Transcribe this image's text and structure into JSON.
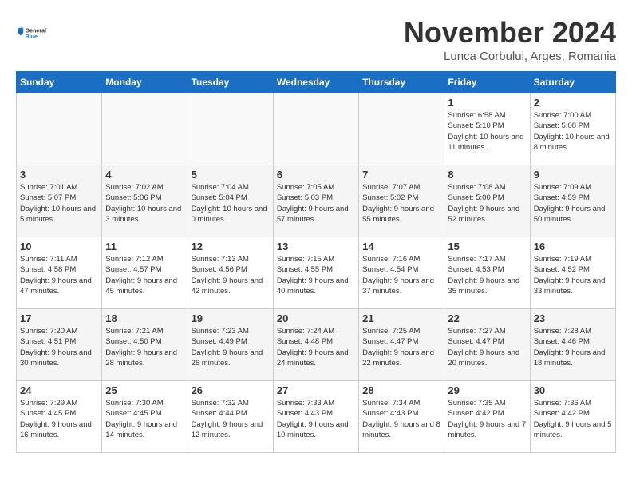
{
  "logo": {
    "line1": "General",
    "line2": "Blue"
  },
  "title": "November 2024",
  "location": "Lunca Corbului, Arges, Romania",
  "weekdays": [
    "Sunday",
    "Monday",
    "Tuesday",
    "Wednesday",
    "Thursday",
    "Friday",
    "Saturday"
  ],
  "weeks": [
    [
      {
        "day": "",
        "info": ""
      },
      {
        "day": "",
        "info": ""
      },
      {
        "day": "",
        "info": ""
      },
      {
        "day": "",
        "info": ""
      },
      {
        "day": "",
        "info": ""
      },
      {
        "day": "1",
        "info": "Sunrise: 6:58 AM\nSunset: 5:10 PM\nDaylight: 10 hours and 11 minutes."
      },
      {
        "day": "2",
        "info": "Sunrise: 7:00 AM\nSunset: 5:08 PM\nDaylight: 10 hours and 8 minutes."
      }
    ],
    [
      {
        "day": "3",
        "info": "Sunrise: 7:01 AM\nSunset: 5:07 PM\nDaylight: 10 hours and 5 minutes."
      },
      {
        "day": "4",
        "info": "Sunrise: 7:02 AM\nSunset: 5:06 PM\nDaylight: 10 hours and 3 minutes."
      },
      {
        "day": "5",
        "info": "Sunrise: 7:04 AM\nSunset: 5:04 PM\nDaylight: 10 hours and 0 minutes."
      },
      {
        "day": "6",
        "info": "Sunrise: 7:05 AM\nSunset: 5:03 PM\nDaylight: 9 hours and 57 minutes."
      },
      {
        "day": "7",
        "info": "Sunrise: 7:07 AM\nSunset: 5:02 PM\nDaylight: 9 hours and 55 minutes."
      },
      {
        "day": "8",
        "info": "Sunrise: 7:08 AM\nSunset: 5:00 PM\nDaylight: 9 hours and 52 minutes."
      },
      {
        "day": "9",
        "info": "Sunrise: 7:09 AM\nSunset: 4:59 PM\nDaylight: 9 hours and 50 minutes."
      }
    ],
    [
      {
        "day": "10",
        "info": "Sunrise: 7:11 AM\nSunset: 4:58 PM\nDaylight: 9 hours and 47 minutes."
      },
      {
        "day": "11",
        "info": "Sunrise: 7:12 AM\nSunset: 4:57 PM\nDaylight: 9 hours and 45 minutes."
      },
      {
        "day": "12",
        "info": "Sunrise: 7:13 AM\nSunset: 4:56 PM\nDaylight: 9 hours and 42 minutes."
      },
      {
        "day": "13",
        "info": "Sunrise: 7:15 AM\nSunset: 4:55 PM\nDaylight: 9 hours and 40 minutes."
      },
      {
        "day": "14",
        "info": "Sunrise: 7:16 AM\nSunset: 4:54 PM\nDaylight: 9 hours and 37 minutes."
      },
      {
        "day": "15",
        "info": "Sunrise: 7:17 AM\nSunset: 4:53 PM\nDaylight: 9 hours and 35 minutes."
      },
      {
        "day": "16",
        "info": "Sunrise: 7:19 AM\nSunset: 4:52 PM\nDaylight: 9 hours and 33 minutes."
      }
    ],
    [
      {
        "day": "17",
        "info": "Sunrise: 7:20 AM\nSunset: 4:51 PM\nDaylight: 9 hours and 30 minutes."
      },
      {
        "day": "18",
        "info": "Sunrise: 7:21 AM\nSunset: 4:50 PM\nDaylight: 9 hours and 28 minutes."
      },
      {
        "day": "19",
        "info": "Sunrise: 7:23 AM\nSunset: 4:49 PM\nDaylight: 9 hours and 26 minutes."
      },
      {
        "day": "20",
        "info": "Sunrise: 7:24 AM\nSunset: 4:48 PM\nDaylight: 9 hours and 24 minutes."
      },
      {
        "day": "21",
        "info": "Sunrise: 7:25 AM\nSunset: 4:47 PM\nDaylight: 9 hours and 22 minutes."
      },
      {
        "day": "22",
        "info": "Sunrise: 7:27 AM\nSunset: 4:47 PM\nDaylight: 9 hours and 20 minutes."
      },
      {
        "day": "23",
        "info": "Sunrise: 7:28 AM\nSunset: 4:46 PM\nDaylight: 9 hours and 18 minutes."
      }
    ],
    [
      {
        "day": "24",
        "info": "Sunrise: 7:29 AM\nSunset: 4:45 PM\nDaylight: 9 hours and 16 minutes."
      },
      {
        "day": "25",
        "info": "Sunrise: 7:30 AM\nSunset: 4:45 PM\nDaylight: 9 hours and 14 minutes."
      },
      {
        "day": "26",
        "info": "Sunrise: 7:32 AM\nSunset: 4:44 PM\nDaylight: 9 hours and 12 minutes."
      },
      {
        "day": "27",
        "info": "Sunrise: 7:33 AM\nSunset: 4:43 PM\nDaylight: 9 hours and 10 minutes."
      },
      {
        "day": "28",
        "info": "Sunrise: 7:34 AM\nSunset: 4:43 PM\nDaylight: 9 hours and 8 minutes."
      },
      {
        "day": "29",
        "info": "Sunrise: 7:35 AM\nSunset: 4:42 PM\nDaylight: 9 hours and 7 minutes."
      },
      {
        "day": "30",
        "info": "Sunrise: 7:36 AM\nSunset: 4:42 PM\nDaylight: 9 hours and 5 minutes."
      }
    ]
  ]
}
